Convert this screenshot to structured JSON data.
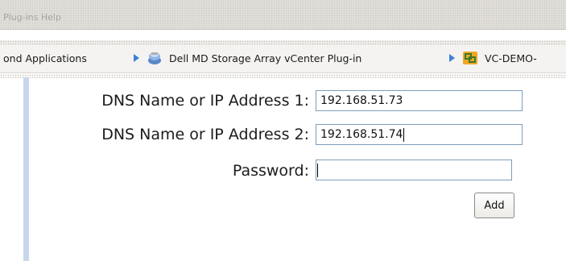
{
  "menubar": {
    "items_text": "Plug-ins   Help"
  },
  "breadcrumbs": [
    {
      "label": "ond Applications",
      "icon": "none"
    },
    {
      "label": "Dell MD Storage Array vCenter Plug-in",
      "icon": "storage-plugin-icon"
    },
    {
      "label": "VC-DEMO-",
      "icon": "vcenter-icon"
    }
  ],
  "form": {
    "dns1_label": "DNS Name or IP Address 1:",
    "dns1_value": "192.168.51.73",
    "dns2_label": "DNS Name or IP Address 2:",
    "dns2_value": "192.168.51.74",
    "password_label": "Password:",
    "password_value": "",
    "add_button": "Add"
  },
  "colors": {
    "accent_arrow": "#3e7fd6",
    "input_border": "#7f9db9",
    "left_strip": "#c9d7ea"
  }
}
